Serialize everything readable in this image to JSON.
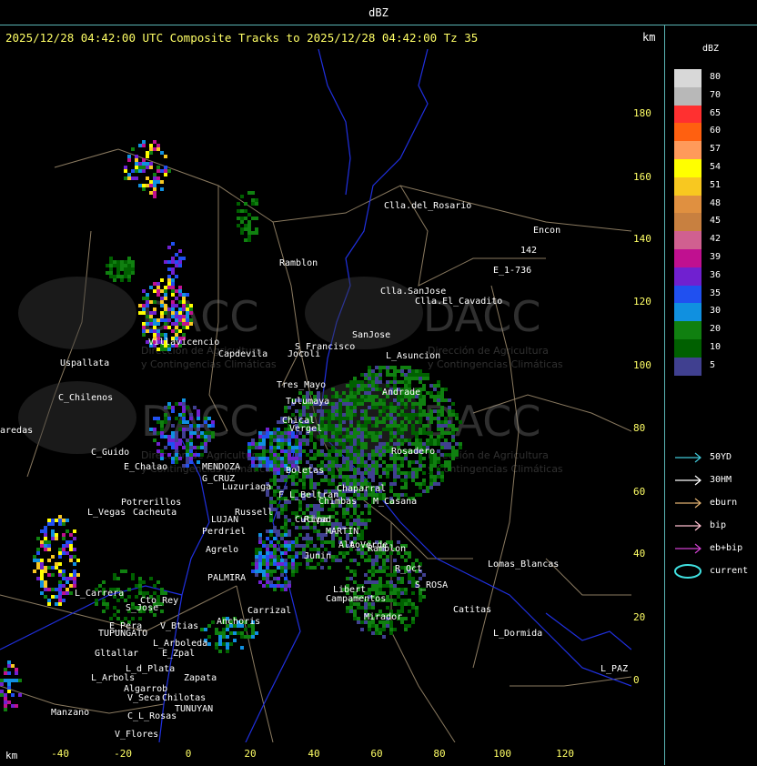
{
  "window": {
    "title": "dBZ"
  },
  "header": {
    "subtitle": "2025/12/28 04:42:00 UTC Composite Tracks to 2025/12/28 04:42:00 Tz 35",
    "units_top": "km",
    "units_bottom": "km"
  },
  "axes": {
    "y_ticks": [
      "180",
      "160",
      "140",
      "120",
      "100",
      "80",
      "60",
      "40",
      "20",
      "0"
    ],
    "x_ticks": [
      "-40",
      "-20",
      "0",
      "20",
      "40",
      "60",
      "80",
      "100",
      "120"
    ],
    "tick_color": "#ffff66"
  },
  "legend": {
    "title": "dBZ",
    "levels": [
      {
        "label": "80",
        "color": "#d8d8d8"
      },
      {
        "label": "70",
        "color": "#b8b8b8"
      },
      {
        "label": "65",
        "color": "#ff3030"
      },
      {
        "label": "60",
        "color": "#ff6010"
      },
      {
        "label": "57",
        "color": "#ff9a5a"
      },
      {
        "label": "54",
        "color": "#ffff00"
      },
      {
        "label": "51",
        "color": "#f8c820"
      },
      {
        "label": "48",
        "color": "#e09040"
      },
      {
        "label": "45",
        "color": "#c88040"
      },
      {
        "label": "42",
        "color": "#d06090"
      },
      {
        "label": "39",
        "color": "#c01090"
      },
      {
        "label": "36",
        "color": "#7020d0"
      },
      {
        "label": "35",
        "color": "#2050f0"
      },
      {
        "label": "30",
        "color": "#1090e0"
      },
      {
        "label": "20",
        "color": "#108010"
      },
      {
        "label": "10",
        "color": "#006000"
      },
      {
        "label": "5",
        "color": "#404090"
      }
    ],
    "tracks": [
      {
        "label": "50YD",
        "color": "#40c8d8",
        "icon": "arrow-right-icon"
      },
      {
        "label": "30HM",
        "color": "#ffffff",
        "icon": "arrow-right-icon"
      },
      {
        "label": "eburn",
        "color": "#e0b070",
        "icon": "arrow-right-icon"
      },
      {
        "label": "bip",
        "color": "#ffc0d0",
        "icon": "arrow-right-icon"
      },
      {
        "label": "eb+bip",
        "color": "#d040d0",
        "icon": "arrow-right-icon"
      },
      {
        "label": "current",
        "color": "#40e0e0",
        "icon": "ellipse-icon"
      }
    ]
  },
  "watermark": {
    "brand": "DACC",
    "line1": "Dirección de Agricultura",
    "line2": "y Contingencias Climáticas"
  },
  "places": [
    {
      "name": "Clla.del_Rosario"
    },
    {
      "name": "Encon"
    },
    {
      "name": "142"
    },
    {
      "name": "E_1-736"
    },
    {
      "name": "Ramblon"
    },
    {
      "name": "Clla.SanJose"
    },
    {
      "name": "Clla.El_Cavadito"
    },
    {
      "name": "Villavicencio"
    },
    {
      "name": "Capdevila"
    },
    {
      "name": "Jocoli"
    },
    {
      "name": "S_Francisco"
    },
    {
      "name": "SanJose"
    },
    {
      "name": "L_Asuncion"
    },
    {
      "name": "Uspallata"
    },
    {
      "name": "Tres_Mayo"
    },
    {
      "name": "C_Chilenos"
    },
    {
      "name": "Tulumaya"
    },
    {
      "name": "aredas"
    },
    {
      "name": "Chical"
    },
    {
      "name": "Vergel"
    },
    {
      "name": "Rosadero"
    },
    {
      "name": "C_Guido"
    },
    {
      "name": "E_Chalao"
    },
    {
      "name": "MENDOZA"
    },
    {
      "name": "Boletas"
    },
    {
      "name": "G_CRUZ"
    },
    {
      "name": "Luzuriaga"
    },
    {
      "name": "Chaparral"
    },
    {
      "name": "F_L_Beltran"
    },
    {
      "name": "Chimbas"
    },
    {
      "name": "M_Casana"
    },
    {
      "name": "Potrerillos"
    },
    {
      "name": "L_Vegas"
    },
    {
      "name": "Cacheuta"
    },
    {
      "name": "Perdriel"
    },
    {
      "name": "MARTIN"
    },
    {
      "name": "A_Verde"
    },
    {
      "name": "Ramblon"
    },
    {
      "name": "Agrelo"
    },
    {
      "name": "PALMIRA"
    },
    {
      "name": "R_Oct"
    },
    {
      "name": "Lomas_Blancas"
    },
    {
      "name": "L_Carrera"
    },
    {
      "name": "Cto_Rey"
    },
    {
      "name": "S_Jose"
    },
    {
      "name": "Campamentos"
    },
    {
      "name": "S_ROSA"
    },
    {
      "name": "Catitas"
    },
    {
      "name": "Carrizal"
    },
    {
      "name": "Mirador"
    },
    {
      "name": "Anchoris"
    },
    {
      "name": "E_Pera"
    },
    {
      "name": "V_Btias"
    },
    {
      "name": "TUPUNGATO"
    },
    {
      "name": "L_Dormida"
    },
    {
      "name": "L_Arboleda"
    },
    {
      "name": "Gltallar"
    },
    {
      "name": "E_Zpal"
    },
    {
      "name": "L_d_Plata"
    },
    {
      "name": "L_Arbols"
    },
    {
      "name": "Zapata"
    },
    {
      "name": "L_PAZ"
    },
    {
      "name": "Algarrob"
    },
    {
      "name": "V_Seca"
    },
    {
      "name": "Chilotas"
    },
    {
      "name": "TUNUYAN"
    },
    {
      "name": "Manzano"
    },
    {
      "name": "C_L_Rosas"
    },
    {
      "name": "V_Flores"
    },
    {
      "name": "Rivad"
    },
    {
      "name": "LUJAN"
    },
    {
      "name": "Russell"
    },
    {
      "name": "Cutipa"
    },
    {
      "name": "Alto"
    },
    {
      "name": "Junin"
    },
    {
      "name": "Libert"
    },
    {
      "name": "Andrade"
    }
  ]
}
